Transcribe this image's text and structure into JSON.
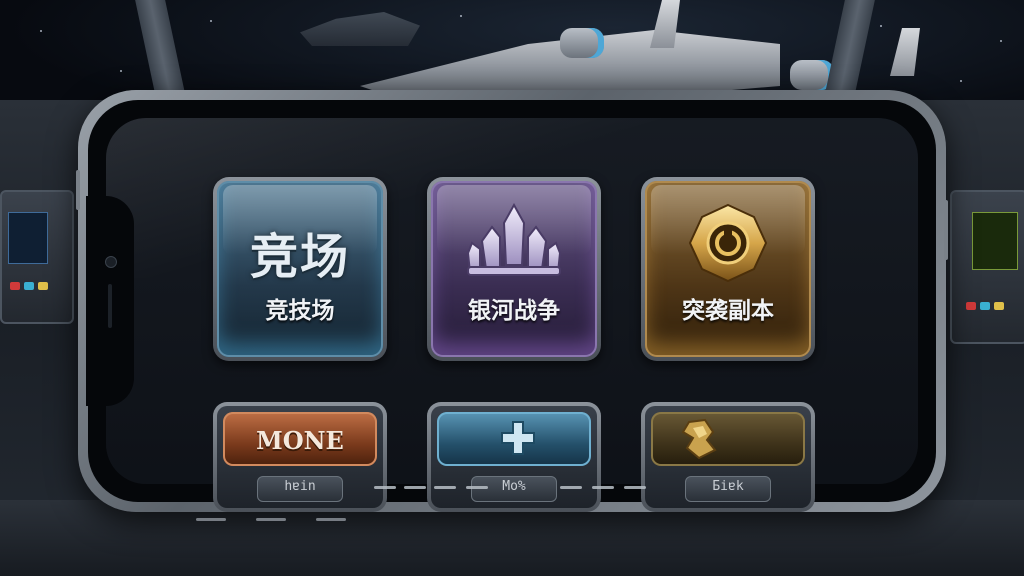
{
  "menu": {
    "main_tiles": [
      {
        "id": "arena",
        "big_text": "竞场",
        "label": "竞技场",
        "icon": "arena-text-emblem"
      },
      {
        "id": "galaxy",
        "big_text": "",
        "label": "银河战争",
        "icon": "crystal-crown-icon"
      },
      {
        "id": "raid",
        "big_text": "",
        "label": "突袭副本",
        "icon": "golden-shield-icon"
      }
    ],
    "lower_tiles": [
      {
        "id": "mone",
        "title": "MONE",
        "sub": "hɐin",
        "icon": ""
      },
      {
        "id": "plus",
        "title": "",
        "sub": "Mo%",
        "icon": "plus-cross-icon"
      },
      {
        "id": "gold",
        "title": "",
        "sub": "Ƃiɐk",
        "icon": "gold-shard-icon"
      }
    ]
  },
  "colors": {
    "arena_accent": "#5e8da8",
    "galaxy_accent": "#8a76ae",
    "raid_accent": "#b08a4e",
    "mone_accent": "#c07046"
  }
}
